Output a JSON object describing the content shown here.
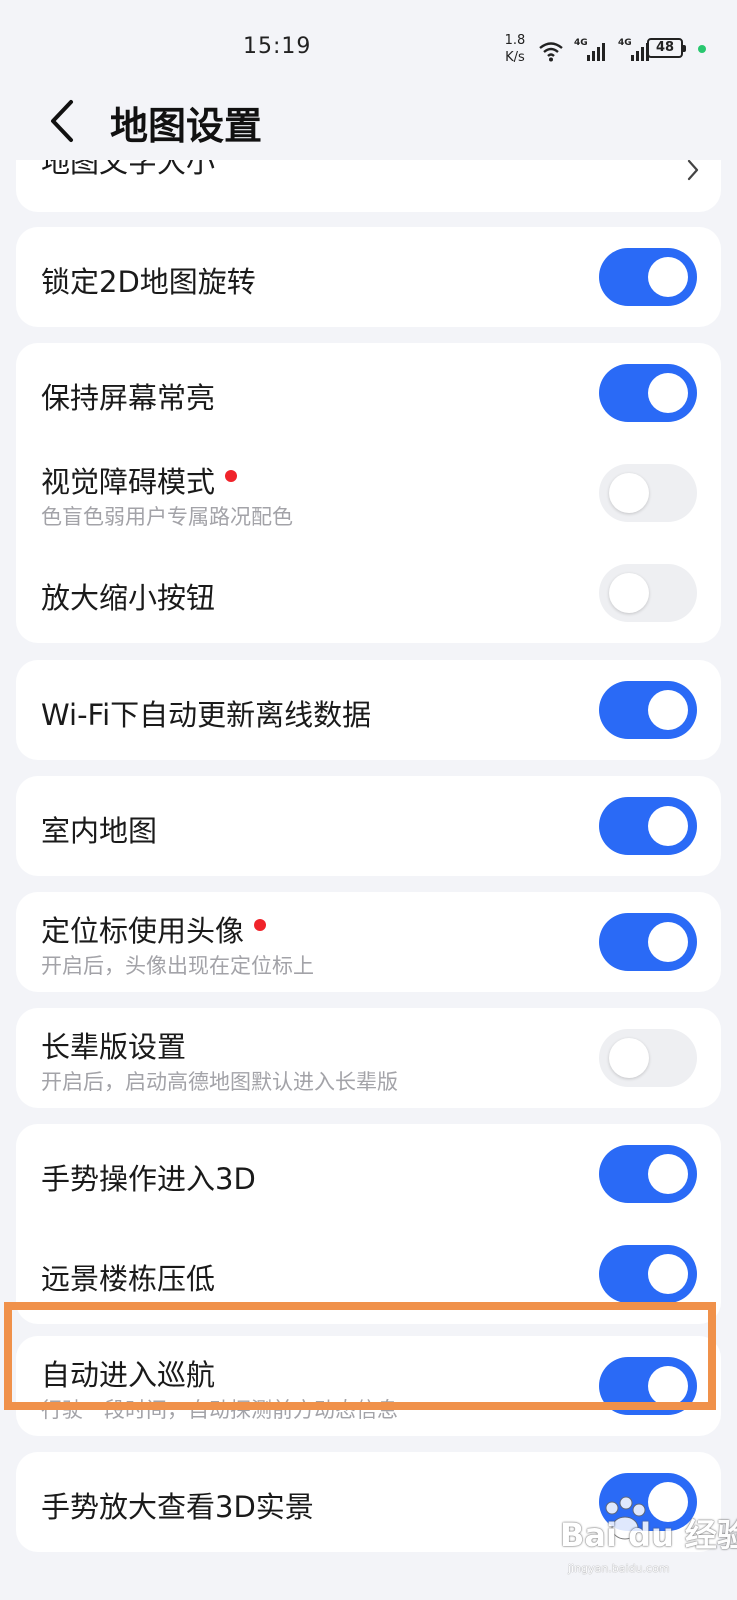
{
  "status_bar": {
    "time": "15:19",
    "net_speed_value": "1.8",
    "net_speed_unit": "K/s",
    "sim1_label": "4G",
    "sim2_label": "4G",
    "battery_level": "48",
    "dot_color": "#28c76f"
  },
  "header": {
    "title": "地图设置",
    "back_icon": "chevron-left-icon"
  },
  "colors": {
    "toggle_on": "#2a6af6",
    "toggle_off": "#eeeff2",
    "red_dot": "#f0232a",
    "highlight": "#f0914a"
  },
  "settings": {
    "map_text_size": {
      "label": "地图文字大小",
      "icon": "chevron-right-icon"
    },
    "lock_2d_rotation": {
      "label": "锁定2D地图旋转",
      "enabled": true
    },
    "keep_screen_on": {
      "label": "保持屏幕常亮",
      "enabled": true
    },
    "visual_impairment_mode": {
      "label": "视觉障碍模式",
      "description": "色盲色弱用户专属路况配色",
      "new_badge": true,
      "enabled": false
    },
    "zoom_buttons": {
      "label": "放大缩小按钮",
      "enabled": false
    },
    "wifi_auto_update": {
      "label": "Wi-Fi下自动更新离线数据",
      "enabled": true
    },
    "indoor_map": {
      "label": "室内地图",
      "enabled": true
    },
    "avatar_locator": {
      "label": "定位标使用头像",
      "description": "开启后，头像出现在定位标上",
      "new_badge": true,
      "enabled": true
    },
    "elder_mode": {
      "label": "长辈版设置",
      "description": "开启后，启动高德地图默认进入长辈版",
      "enabled": false
    },
    "gesture_3d": {
      "label": "手势操作进入3D",
      "enabled": true
    },
    "distant_buildings_low": {
      "label": "远景楼栋压低",
      "enabled": true
    },
    "auto_cruise": {
      "label": "自动进入巡航",
      "description": "行驶一段时间，自动探测前方动态信息",
      "enabled": true
    },
    "gesture_3d_live_view": {
      "label": "手势放大查看3D实景",
      "enabled": true
    }
  },
  "watermark": {
    "text": "Bai du 经验",
    "subtext": "jingyan.baidu.com"
  }
}
